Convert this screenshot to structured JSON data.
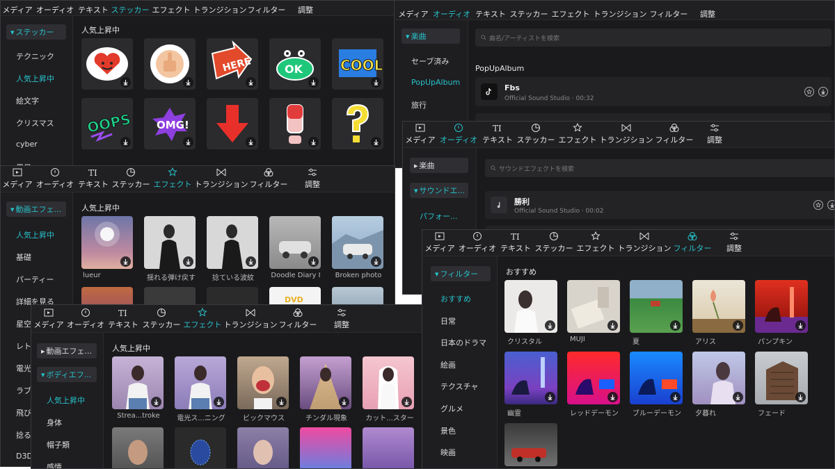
{
  "tabs": {
    "media": "メディア",
    "audio": "オーディオ",
    "text": "テキスト",
    "sticker": "ステッカー",
    "effect": "エフェクト",
    "transition": "トランジション",
    "filter": "フィルター",
    "adjust": "調整"
  },
  "sticker_panel": {
    "sidebar": {
      "category": "ステッカー",
      "items": [
        "テクニック",
        "人気上昇中",
        "絵文字",
        "クリスマス",
        "cyber",
        "祭日"
      ]
    },
    "section": "人気上昇中"
  },
  "audio_panel": {
    "sidebar": {
      "category": "楽曲",
      "items": [
        "セーブ済み",
        "PopUpAlbum",
        "旅行"
      ]
    },
    "search_placeholder": "曲名/アーティストを検索",
    "section": "PopUpAlbum",
    "track": {
      "title": "Fbs",
      "subtitle": "Official Sound Studio · 00:32"
    }
  },
  "effect_panel": {
    "sidebar": {
      "category": "動画エフェ...",
      "items": [
        "人気上昇中",
        "基礎",
        "パーティー",
        "詳細を見る",
        "星空",
        "レトロ",
        "電光",
        "ラブ",
        "飛び",
        "捻る",
        "D3D"
      ]
    },
    "section": "人気上昇中",
    "captions": [
      "lueur",
      "揺れる弾け戻す",
      "捻ている波紋",
      "Doodle Diary I",
      "Broken photo"
    ]
  },
  "sfx_panel": {
    "sidebar": {
      "category1": "楽曲",
      "category2": "サウンドエ...",
      "items": [
        "パフォー..."
      ]
    },
    "search_placeholder": "サウンドエフェクトを検索",
    "track": {
      "title": "勝利",
      "subtitle": "Official Sound Studio · 00:02"
    }
  },
  "body_panel": {
    "sidebar": {
      "category1": "動画エフェ...",
      "category2": "ボディエフ...",
      "items": [
        "人気上昇中",
        "身体",
        "帽子類",
        "感情"
      ]
    },
    "section": "人気上昇中",
    "captions": [
      "Strea...troke",
      "電光ス...ニング",
      "ビックマウス",
      "チンダル現象",
      "カット...スター"
    ]
  },
  "filter_panel": {
    "sidebar": {
      "category": "フィルター",
      "items": [
        "おすすめ",
        "日常",
        "日本のドラマ",
        "絵画",
        "テクスチャ",
        "グルメ",
        "景色",
        "映画"
      ]
    },
    "section": "おすすめ",
    "captions": [
      "クリスタル",
      "MUJI",
      "夏",
      "アリス",
      "パンプキン",
      "幽霊",
      "レッドデーモン",
      "ブルーデーモン",
      "夕暮れ",
      "フェード"
    ]
  }
}
